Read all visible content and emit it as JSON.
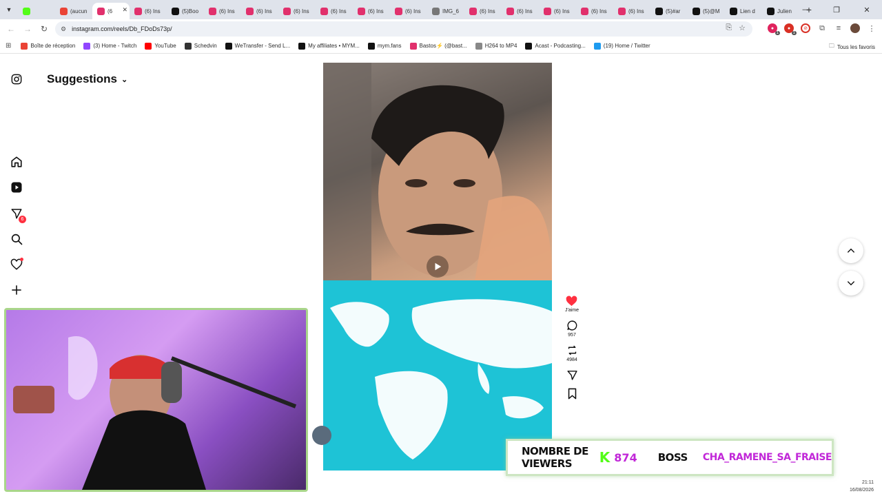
{
  "browser": {
    "tabs": [
      {
        "label": "",
        "color": "#53fc18",
        "active": false
      },
      {
        "label": "(aucun",
        "color": "#ea4335",
        "active": false
      },
      {
        "label": "(6",
        "color": "#e1306c",
        "active": true
      },
      {
        "label": "(6) Ins",
        "color": "#e1306c",
        "active": false
      },
      {
        "label": "(5)Boo",
        "color": "#111111",
        "active": false
      },
      {
        "label": "(6) Ins",
        "color": "#e1306c",
        "active": false
      },
      {
        "label": "(6) Ins",
        "color": "#e1306c",
        "active": false
      },
      {
        "label": "(6) Ins",
        "color": "#e1306c",
        "active": false
      },
      {
        "label": "(6) Ins",
        "color": "#e1306c",
        "active": false
      },
      {
        "label": "(6) Ins",
        "color": "#e1306c",
        "active": false
      },
      {
        "label": "(6) Ins",
        "color": "#e1306c",
        "active": false
      },
      {
        "label": "IMG_6",
        "color": "#777777",
        "active": false
      },
      {
        "label": "(6) Ins",
        "color": "#e1306c",
        "active": false
      },
      {
        "label": "(6) Ins",
        "color": "#e1306c",
        "active": false
      },
      {
        "label": "(6) Ins",
        "color": "#e1306c",
        "active": false
      },
      {
        "label": "(6) Ins",
        "color": "#e1306c",
        "active": false
      },
      {
        "label": "(6) Ins",
        "color": "#e1306c",
        "active": false
      },
      {
        "label": "(5)#ar",
        "color": "#111111",
        "active": false
      },
      {
        "label": "(5)@M",
        "color": "#111111",
        "active": false
      },
      {
        "label": "Lien d",
        "color": "#111111",
        "active": false
      },
      {
        "label": "Julien",
        "color": "#111111",
        "active": false
      }
    ],
    "url": "instagram.com/reels/Db_FDoDs73p/",
    "bookmarks": [
      {
        "label": "Boîte de réception",
        "color": "#ea4335"
      },
      {
        "label": "(3) Home - Twitch",
        "color": "#9146ff"
      },
      {
        "label": "YouTube",
        "color": "#ff0000"
      },
      {
        "label": "Schedvin",
        "color": "#333333"
      },
      {
        "label": "WeTransfer - Send L...",
        "color": "#111111"
      },
      {
        "label": "My affiliates • MYM...",
        "color": "#111111"
      },
      {
        "label": "mym.fans",
        "color": "#111111"
      },
      {
        "label": "Bastos⚡ (@bast...",
        "color": "#e1306c"
      },
      {
        "label": "H264 to MP4",
        "color": "#888888"
      },
      {
        "label": "Acast - Podcasting...",
        "color": "#111111"
      },
      {
        "label": "(19) Home / Twitter",
        "color": "#1d9bf0"
      }
    ],
    "all_bookmarks": "Tous les favoris"
  },
  "instagram": {
    "suggestions_label": "Suggestions",
    "notifications_badge": "6",
    "likes_label": "J'aime",
    "comments_count": "957",
    "reposts_count": "4984",
    "like_color": "#ff3040"
  },
  "overlay": {
    "viewers_label": "NOMBRE DE VIEWERS",
    "k_logo": "K",
    "viewers_count": "874",
    "boss_label": "BOSS",
    "boss_user": "CHA_RAMENE_SA_FRAISE",
    "accent_green": "#53fc18",
    "accent_purple": "#c127d8"
  },
  "taskbar": {
    "time": "21:11",
    "date": "16/08/2026"
  }
}
